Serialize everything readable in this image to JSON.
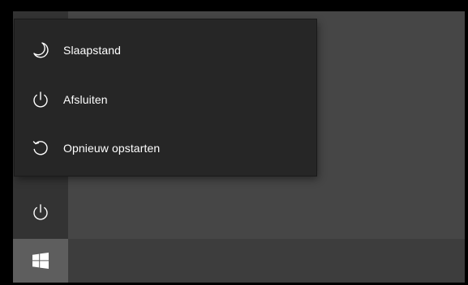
{
  "power_menu": {
    "items": [
      {
        "label": "Slaapstand",
        "icon": "moon-icon"
      },
      {
        "label": "Afsluiten",
        "icon": "power-icon"
      },
      {
        "label": "Opnieuw opstarten",
        "icon": "restart-icon"
      }
    ]
  },
  "rail": {
    "power_icon": "power-icon"
  },
  "taskbar": {
    "start_icon": "windows-logo-icon"
  },
  "colors": {
    "menu_background": "#262626",
    "start_background": "#464646",
    "taskbar_background": "#3d3d3d",
    "start_button_active": "#5e5e5e",
    "text": "#ffffff"
  }
}
